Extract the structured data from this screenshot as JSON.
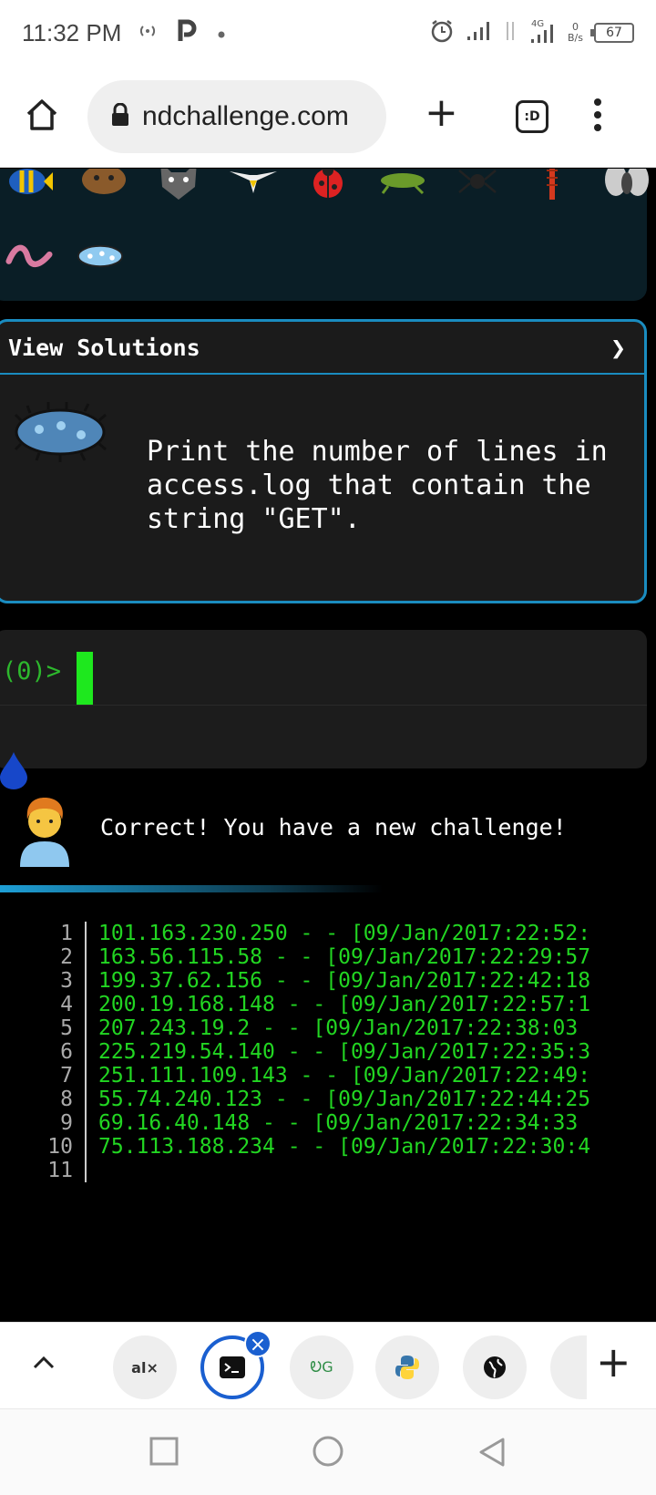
{
  "status_bar": {
    "time": "11:32 PM",
    "icons": [
      "hotspot-icon",
      "p-app-icon",
      "dot-icon",
      "alarm-icon",
      "signal-icon",
      "4g-signal-icon"
    ],
    "network_speed_value": "0",
    "network_speed_unit": "B/s",
    "battery": "67"
  },
  "browser": {
    "url": "ndchallenge.com",
    "tabs_label": ":D"
  },
  "solutions": {
    "title": "View Solutions",
    "chevron": "❯",
    "challenge_text": "Print the number of lines in access.log that contain the string \"GET\"."
  },
  "terminal": {
    "prompt": "(0)>",
    "input_value": ""
  },
  "message": {
    "text": "Correct! You have a new challenge!"
  },
  "code": {
    "line_numbers": [
      "1",
      "2",
      "3",
      "4",
      "5",
      "6",
      "7",
      "8",
      "9",
      "10",
      "11"
    ],
    "lines": [
      "101.163.230.250 - - [09/Jan/2017:22:52:",
      "163.56.115.58 - - [09/Jan/2017:22:29:57",
      "199.37.62.156 - - [09/Jan/2017:22:42:18",
      "200.19.168.148 - - [09/Jan/2017:22:57:1",
      "207.243.19.2 - - [09/Jan/2017:22:38:03 ",
      "225.219.54.140 - - [09/Jan/2017:22:35:3",
      "251.111.109.143 - - [09/Jan/2017:22:49:",
      "55.74.240.123 - - [09/Jan/2017:22:44:25",
      "69.16.40.148 - - [09/Jan/2017:22:34:33 ",
      "75.113.188.234 - - [09/Jan/2017:22:30:4",
      ""
    ]
  },
  "tab_strip": {
    "tabs": [
      {
        "name": "alx",
        "label": "al×"
      },
      {
        "name": "terminal",
        "label": ">_"
      },
      {
        "name": "geeksforgeeks",
        "label": "ᎧG"
      },
      {
        "name": "python",
        "label": ""
      },
      {
        "name": "globe",
        "label": ""
      }
    ],
    "accent": "#1a5fd0"
  },
  "colors": {
    "accent_border": "#1a8cc0",
    "terminal_green": "#22d622"
  }
}
